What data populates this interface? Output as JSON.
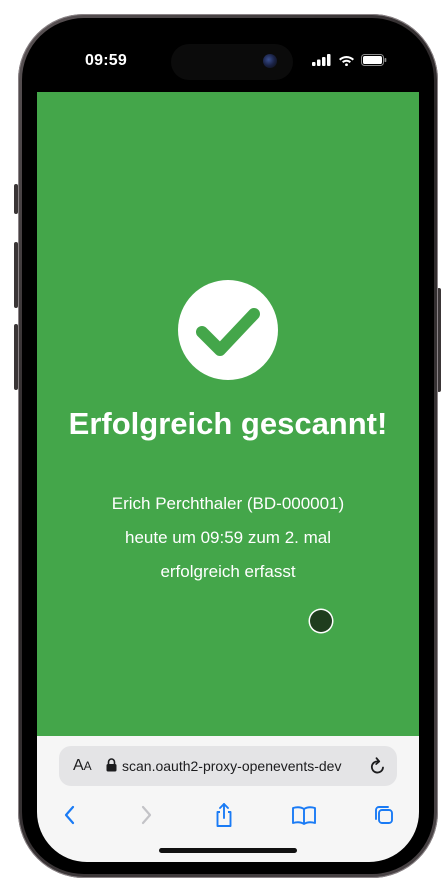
{
  "status_bar": {
    "time": "09:59"
  },
  "icons": {
    "signal": "signal-bars-icon",
    "wifi": "wifi-icon",
    "battery": "battery-icon",
    "success": "checkmark-icon",
    "lock": "lock-icon",
    "reload": "reload-icon",
    "back": "back-chevron-icon",
    "forward": "forward-chevron-icon",
    "share": "share-icon",
    "bookmarks": "bookmarks-book-icon",
    "tabs": "tabs-icon"
  },
  "app": {
    "headline": "Erfolgreich gescannt!",
    "message_lines": [
      "Erich Perchthaler (BD-000001)",
      "heute um 09:59 zum 2. mal",
      "erfolgreich erfasst"
    ]
  },
  "browser": {
    "aa_large": "A",
    "aa_small": "A",
    "url": "scan.oauth2-proxy-openevents-dev"
  },
  "colors": {
    "background_success": "#44a64a",
    "check": "#44a64a",
    "text": "#ffffff",
    "accent_blue": "#1a7bf5"
  }
}
